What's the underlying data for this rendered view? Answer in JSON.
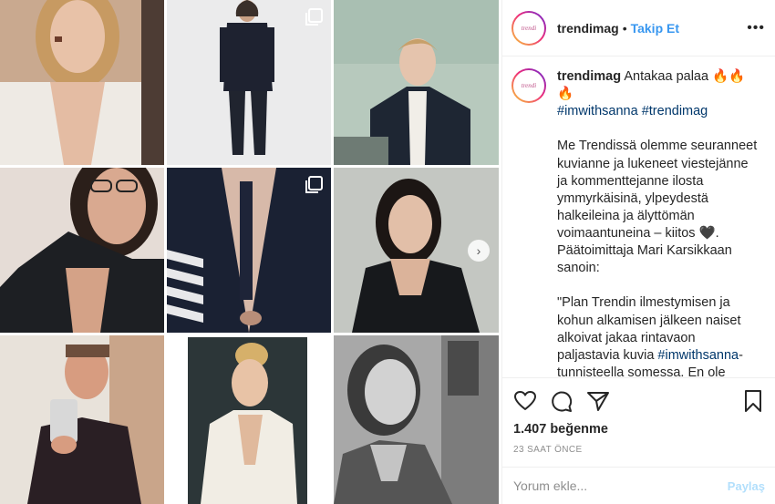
{
  "grid": {
    "tiles": [
      {
        "name": "photo-1"
      },
      {
        "name": "photo-2",
        "multi": true
      },
      {
        "name": "photo-3"
      },
      {
        "name": "photo-4"
      },
      {
        "name": "photo-5",
        "multi": true
      },
      {
        "name": "photo-6",
        "next": true
      },
      {
        "name": "photo-7"
      },
      {
        "name": "photo-8"
      },
      {
        "name": "photo-9"
      }
    ]
  },
  "post": {
    "username": "trendimag",
    "follow_label": "Takip Et",
    "avatar_text": "trendi",
    "caption": {
      "username": "trendimag",
      "intro_text": "Antakaa palaa",
      "emoji": "🔥🔥🔥",
      "hashtag1": "#imwithsanna",
      "hashtag2": "#trendimag",
      "para1": "Me Trendissä olemme seuranneet kuvianne ja lukeneet viestejänne ja kommenttejanne ilosta ymmyrkäisinä, ylpeydestä halkeileina ja älyttömän voimaantuneina – kiitos 🖤. Päätoimittaja Mari Karsikkaan sanoin:",
      "quote_start": "\"Plan Trendin ilmestymisen ja kohun alkamisen jälkeen naiset alkoivat jakaa rintavaon paljastavia kuvia ",
      "quote_hashtag": "#imwithsanna",
      "quote_end": "-tunnisteella somessa. En ole varma, kuka ehti ensin, mutta ei ainakaan Trendi. Someilmiön synnyttivät yksittäiset naiset, joille Sanna Marinin parjaus"
    },
    "likes": "1.407 beğenme",
    "time": "23 SAAT ÖNCE",
    "comment_placeholder": "Yorum ekle...",
    "post_label": "Paylaş"
  },
  "colors": {
    "follow": "#3897f0",
    "hashtag": "#00376b",
    "muted": "#8e8e8e",
    "post_disabled": "#b2dffc"
  },
  "icons": [
    "heart-icon",
    "comment-icon",
    "share-icon",
    "bookmark-icon",
    "more-options-icon",
    "multiple-photos-icon",
    "chevron-right-icon"
  ]
}
